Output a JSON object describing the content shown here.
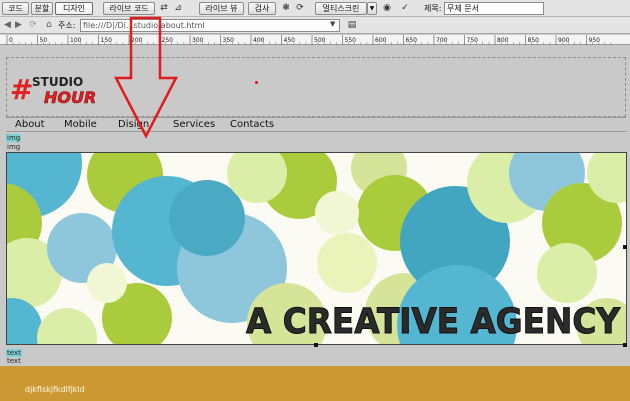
{
  "toolbar": {
    "code": "코드",
    "split": "분할",
    "design": "디자인",
    "live_code": "라이브 코드",
    "live_view": "라이브 뷰",
    "inspect": "검사",
    "multiscreen": "멀티스크린",
    "title_label": "제목:",
    "title_value": "무제 문서"
  },
  "address": {
    "label": "주소:",
    "url": "file:///D|/Di...studio/about.html"
  },
  "ruler": {
    "ticks": [
      "0",
      "50",
      "100",
      "150",
      "200",
      "250",
      "300",
      "350",
      "400",
      "450",
      "500",
      "550",
      "600",
      "650",
      "700",
      "750",
      "800",
      "850",
      "900",
      "950"
    ]
  },
  "logo": {
    "hash": "#",
    "line1": "STUDIO",
    "line2": "HOUR"
  },
  "nav": {
    "items": [
      "About",
      "Mobile",
      "Disign",
      "Services",
      "Contacts"
    ]
  },
  "tags": {
    "img_selected": "img",
    "img": "img",
    "text_selected": "text",
    "text": "text"
  },
  "hero": {
    "headline": "A CREATIVE AGENCY"
  },
  "footer": {
    "text": "djkflskjfkdlfjkld",
    "color": "#cc9934"
  },
  "colors": {
    "accent_red": "#e02020",
    "selection": "#7fd0d6"
  },
  "icons": [
    "back-arrow-icon",
    "forward-arrow-icon",
    "refresh-icon",
    "home-icon",
    "file-compare-icon",
    "visual-aids-icon",
    "dropdown-icon",
    "browser-preview-icon",
    "page-options-icon"
  ]
}
